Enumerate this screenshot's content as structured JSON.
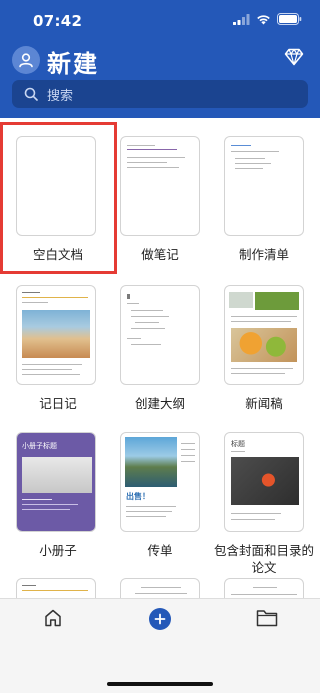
{
  "status_bar": {
    "time": "07:42",
    "icons": [
      "signal-icon",
      "wifi-icon",
      "battery-icon"
    ]
  },
  "header": {
    "title": "新建",
    "avatar_icon": "user-avatar-icon",
    "premium_icon": "diamond-icon",
    "background": "#2458b8"
  },
  "search": {
    "placeholder": "搜索",
    "icon": "search-icon"
  },
  "templates": [
    {
      "label": "空白文档",
      "selected": true
    },
    {
      "label": "做笔记"
    },
    {
      "label": "制作清单"
    },
    {
      "label": "记日记"
    },
    {
      "label": "创建大纲"
    },
    {
      "label": "新闻稿"
    },
    {
      "label": "小册子"
    },
    {
      "label": "传单"
    },
    {
      "label": "包含封面和目录的论文"
    }
  ],
  "thumb_text": {
    "brochure_title": "小册子标题",
    "flyer_title": "出售！",
    "paper_title": "标题"
  },
  "highlight_color": "#e53b34",
  "bottom_nav": {
    "home_icon": "home-icon",
    "new_icon": "plus-circle-icon",
    "folder_icon": "folder-icon"
  }
}
